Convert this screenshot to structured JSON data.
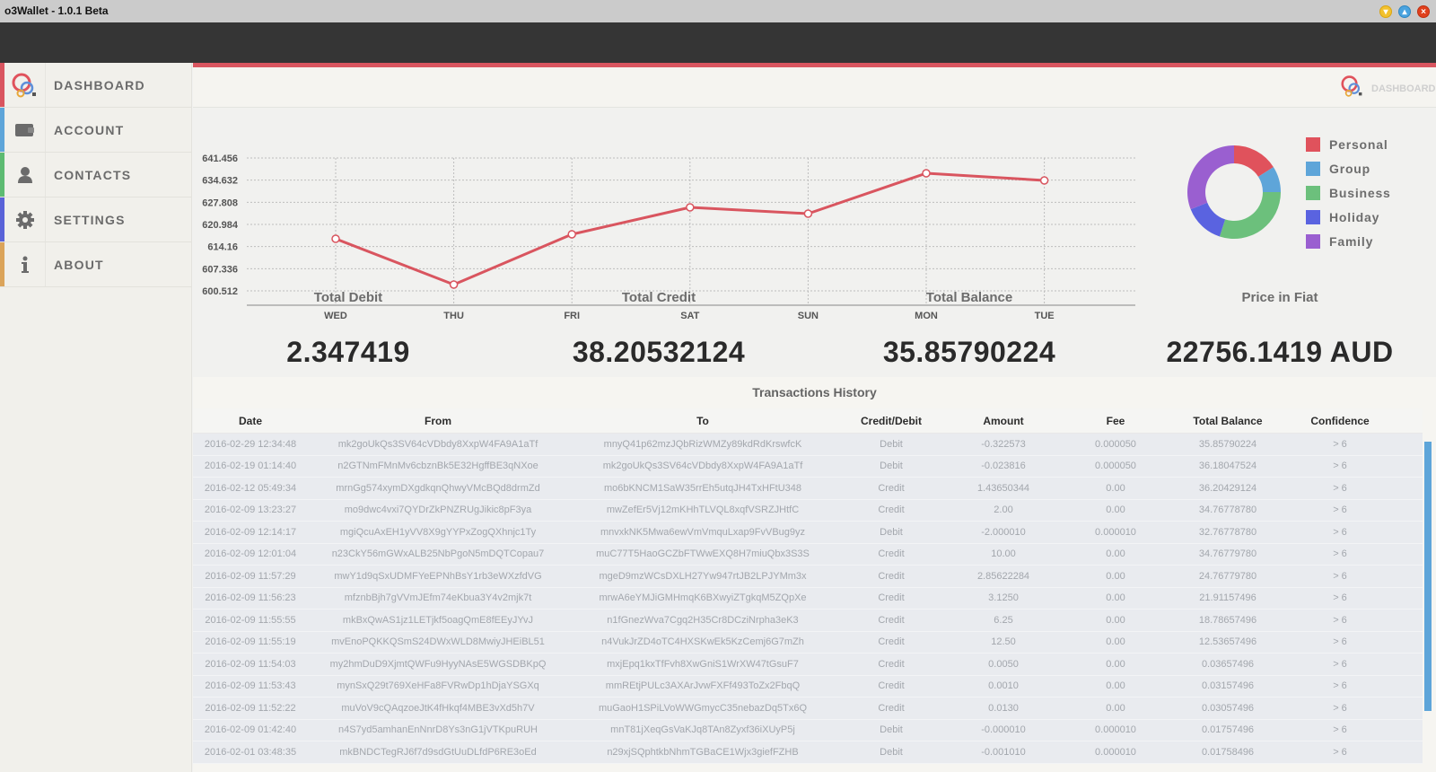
{
  "window": {
    "title": "o3Wallet - 1.0.1 Beta",
    "buttons": {
      "minimize": "▾",
      "maximize": "▴",
      "close": "×"
    }
  },
  "sidebar": {
    "items": [
      {
        "label": "DASHBOARD",
        "icon": "logo-icon",
        "color": "#d9555f"
      },
      {
        "label": "ACCOUNT",
        "icon": "wallet-icon",
        "color": "#5ea5d9"
      },
      {
        "label": "CONTACTS",
        "icon": "user-icon",
        "color": "#5dbb72"
      },
      {
        "label": "SETTINGS",
        "icon": "gear-icon",
        "color": "#5a63d8"
      },
      {
        "label": "ABOUT",
        "icon": "info-icon",
        "color": "#dba45a"
      }
    ]
  },
  "header": {
    "label": "DASHBOARD"
  },
  "chart_data": [
    {
      "type": "line",
      "title": "",
      "categories": [
        "WED",
        "THU",
        "FRI",
        "SAT",
        "SUN",
        "MON",
        "TUE"
      ],
      "values": [
        616.56,
        602.45,
        617.94,
        626.24,
        624.3,
        636.75,
        634.54
      ],
      "yticks": [
        "600.512",
        "607.336",
        "614.16",
        "620.984",
        "627.808",
        "634.632",
        "641.456"
      ],
      "ylim": [
        600.512,
        641.456
      ],
      "grid": true,
      "line_color": "#d9555f",
      "xlabel": "",
      "ylabel": ""
    },
    {
      "type": "pie",
      "donut": true,
      "labels": [
        "Personal",
        "Group",
        "Business",
        "Holiday",
        "Family"
      ],
      "values": [
        16,
        9,
        30,
        14,
        31
      ],
      "colors": [
        "#e0525c",
        "#5ea5d9",
        "#6cc07c",
        "#5a63e0",
        "#9a5fd0"
      ],
      "legend": "right"
    }
  ],
  "stats": [
    {
      "label": "Total Debit",
      "value": "2.347419"
    },
    {
      "label": "Total Credit",
      "value": "38.20532124"
    },
    {
      "label": "Total Balance",
      "value": "35.85790224"
    },
    {
      "label": "Price in Fiat",
      "value": "22756.1419 AUD"
    }
  ],
  "transactions": {
    "title": "Transactions History",
    "columns": [
      "Date",
      "From",
      "To",
      "Credit/Debit",
      "Amount",
      "Fee",
      "Total Balance",
      "Confidence"
    ],
    "rows": [
      [
        "2016-02-29 12:34:48",
        "mk2goUkQs3SV64cVDbdy8XxpW4FA9A1aTf",
        "mnyQ41p62mzJQbRizWMZy89kdRdKrswfcK",
        "Debit",
        "-0.322573",
        "0.000050",
        "35.85790224",
        "> 6"
      ],
      [
        "2016-02-19 01:14:40",
        "n2GTNmFMnMv6cbznBk5E32HgffBE3qNXoe",
        "mk2goUkQs3SV64cVDbdy8XxpW4FA9A1aTf",
        "Debit",
        "-0.023816",
        "0.000050",
        "36.18047524",
        "> 6"
      ],
      [
        "2016-02-12 05:49:34",
        "mrnGg574xymDXgdkqnQhwyVMcBQd8drmZd",
        "mo6bKNCM1SaW35rrEh5utqJH4TxHFtU348",
        "Credit",
        "1.43650344",
        "0.00",
        "36.20429124",
        "> 6"
      ],
      [
        "2016-02-09 13:23:27",
        "mo9dwc4vxi7QYDrZkPNZRUgJikic8pF3ya",
        "mwZefEr5Vj12mKHhTLVQL8xqfVSRZJHtfC",
        "Credit",
        "2.00",
        "0.00",
        "34.76778780",
        "> 6"
      ],
      [
        "2016-02-09 12:14:17",
        "mgiQcuAxEH1yVV8X9gYYPxZogQXhnjc1Ty",
        "mnvxkNK5Mwa6ewVmVmquLxap9FvVBug9yz",
        "Debit",
        "-2.000010",
        "0.000010",
        "32.76778780",
        "> 6"
      ],
      [
        "2016-02-09 12:01:04",
        "n23CkY56mGWxALB25NbPgoN5mDQTCopau7",
        "muC77T5HaoGCZbFTWwEXQ8H7miuQbx3S3S",
        "Credit",
        "10.00",
        "0.00",
        "34.76779780",
        "> 6"
      ],
      [
        "2016-02-09 11:57:29",
        "mwY1d9qSxUDMFYeEPNhBsY1rb3eWXzfdVG",
        "mgeD9mzWCsDXLH27Yw947rtJB2LPJYMm3x",
        "Credit",
        "2.85622284",
        "0.00",
        "24.76779780",
        "> 6"
      ],
      [
        "2016-02-09 11:56:23",
        "mfznbBjh7gVVmJEfm74eKbua3Y4v2mjk7t",
        "mrwA6eYMJiGMHmqK6BXwyiZTgkqM5ZQpXe",
        "Credit",
        "3.1250",
        "0.00",
        "21.91157496",
        "> 6"
      ],
      [
        "2016-02-09 11:55:55",
        "mkBxQwAS1jz1LETjkf5oagQmE8fEEyJYvJ",
        "n1fGnezWva7Cgq2H35Cr8DCziNrpha3eK3",
        "Credit",
        "6.25",
        "0.00",
        "18.78657496",
        "> 6"
      ],
      [
        "2016-02-09 11:55:19",
        "mvEnoPQKKQSmS24DWxWLD8MwiyJHEiBL51",
        "n4VukJrZD4oTC4HXSKwEk5KzCemj6G7mZh",
        "Credit",
        "12.50",
        "0.00",
        "12.53657496",
        "> 6"
      ],
      [
        "2016-02-09 11:54:03",
        "my2hmDuD9XjmtQWFu9HyyNAsE5WGSDBKpQ",
        "mxjEpq1kxTfFvh8XwGniS1WrXW47tGsuF7",
        "Credit",
        "0.0050",
        "0.00",
        "0.03657496",
        "> 6"
      ],
      [
        "2016-02-09 11:53:43",
        "mynSxQ29t769XeHFa8FVRwDp1hDjaYSGXq",
        "mmREtjPULc3AXArJvwFXFf493ToZx2FbqQ",
        "Credit",
        "0.0010",
        "0.00",
        "0.03157496",
        "> 6"
      ],
      [
        "2016-02-09 11:52:22",
        "muVoV9cQAqzoeJtK4fHkqf4MBE3vXd5h7V",
        "muGaoH1SPiLVoWWGmycC35nebazDq5Tx6Q",
        "Credit",
        "0.0130",
        "0.00",
        "0.03057496",
        "> 6"
      ],
      [
        "2016-02-09 01:42:40",
        "n4S7yd5amhanEnNnrD8Ys3nG1jVTKpuRUH",
        "mnT81jXeqGsVaKJq8TAn8Zyxf36iXUyP5j",
        "Debit",
        "-0.000010",
        "0.000010",
        "0.01757496",
        "> 6"
      ],
      [
        "2016-02-01 03:48:35",
        "mkBNDCTegRJ6f7d9sdGtUuDLfdP6RE3oEd",
        "n29xjSQphtkbNhmTGBaCE1Wjx3giefFZHB",
        "Debit",
        "-0.001010",
        "0.000010",
        "0.01758496",
        "> 6"
      ]
    ]
  }
}
